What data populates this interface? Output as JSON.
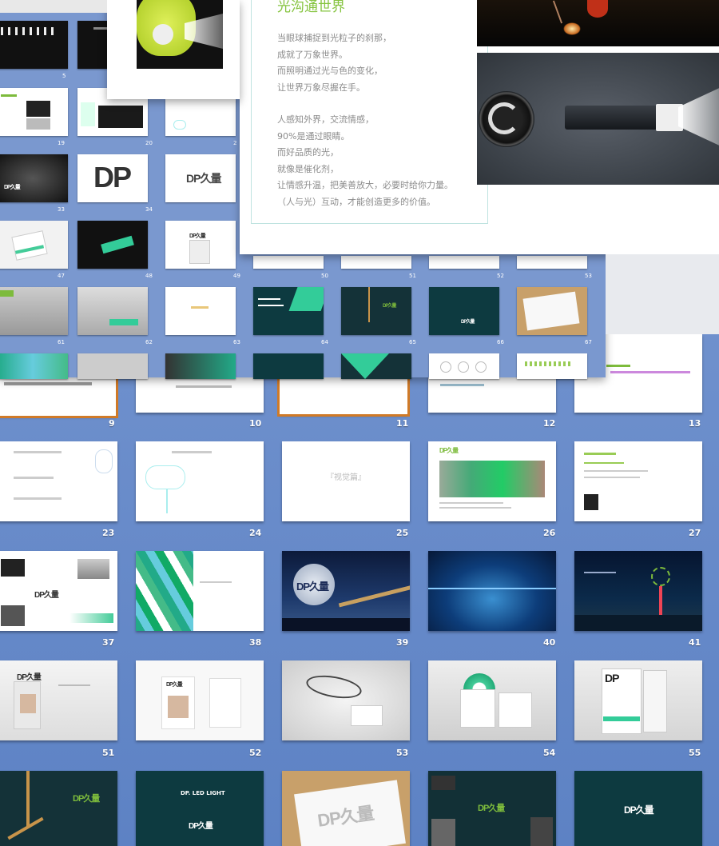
{
  "slide": {
    "title": "光沟通世界",
    "para1": [
      "当眼球捕捉到光粒子的刹那，",
      "成就了万象世界。",
      "而照明通过光与色的变化，",
      "让世界万象尽握在手。"
    ],
    "para2": [
      "人感知外界，交流情感，",
      "90%是通过眼睛。",
      "而好品质的光，",
      "就像是催化剂，",
      "让情感升温，把美善放大，必要时给你力量。",
      "（人与光）互动，才能创造更多的价值。"
    ]
  },
  "mini_grid": {
    "numbers": [
      "5",
      "19",
      "20",
      "2",
      "33",
      "34",
      "47",
      "48",
      "49",
      "50",
      "51",
      "52",
      "53",
      "61",
      "62",
      "63",
      "64",
      "65",
      "66",
      "67"
    ],
    "brand": "DP久量",
    "big_dp": "DP"
  },
  "main_grid": {
    "row1": [
      "9",
      "10",
      "11",
      "12",
      "13"
    ],
    "row2": [
      "23",
      "24",
      "25",
      "26",
      "27"
    ],
    "row3": [
      "37",
      "38",
      "39",
      "40",
      "41"
    ],
    "row4": [
      "51",
      "52",
      "53",
      "54",
      "55"
    ],
    "slide25_text": "『视觉篇』",
    "brand": "DP久量",
    "dp_light": "DP. LED LIGHT"
  },
  "colors": {
    "background": "#6f93cf",
    "accent_green": "#7dbb3c",
    "teal": "#3fbfa0",
    "dark_teal": "#0d3a40",
    "selection": "#d07a27"
  }
}
